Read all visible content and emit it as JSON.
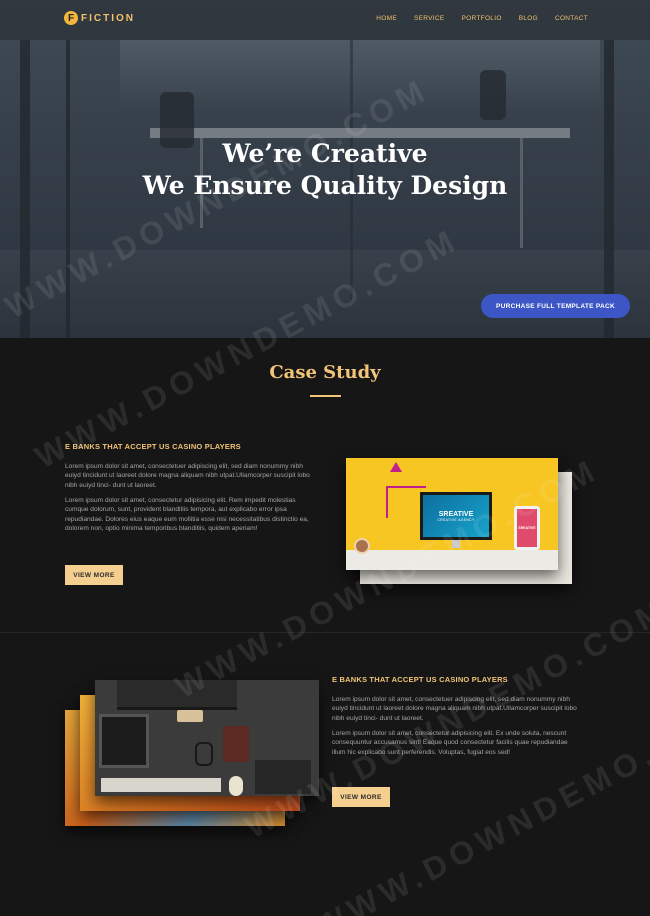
{
  "header": {
    "logo_initial": "F",
    "logo_text": "FICTION",
    "nav": [
      "HOME",
      "SERVICE",
      "PORTFOLIO",
      "BLOG",
      "CONTACT"
    ]
  },
  "hero": {
    "line1": "We’re Creative",
    "line2": "We Ensure Quality Design",
    "cta_label": "PURCHASE FULL TEMPLATE PACK"
  },
  "case_study": {
    "title": "Case Study",
    "items": [
      {
        "heading": "E BANKS THAT ACCEPT US CASINO PLAYERS",
        "para1": "Lorem ipsum dolor sit amet, consectetuer adipiscing elit, sed diam nonummy nibh euiyd tincidunt ut laoreet dolore magna aliquam nibh utpat.Ullamcorper suscipit lobo nibh euiyd tinci- dunt ut laoreet.",
        "para2": "Lorem ipsum dolor sit amet, consectetur adipisicing elit. Rem impedit molestias cumque dolorum, sunt, provident blanditiis tempora, aut explicabo error ipsa repudiandae. Dolores eius eaque eum mollitia esse nisi necessitatibus distinctio ea, dolorem non, optio minima temporibus blanditiis, quidem aperiam!",
        "button": "VIEW MORE",
        "screen_title": "SREATIVE",
        "screen_sub": "CREATIVE AGENCY",
        "phone_text": "SREATIVE"
      },
      {
        "heading": "E BANKS THAT ACCEPT US CASINO PLAYERS",
        "para1": "Lorem ipsum dolor sit amet, consectetuer adipiscing elit, sed diam nonummy nibh euiyd tincidunt ut laoreet dolore magna aliquam nibh utpat.Ullamcorper suscipit lobo nibh euiyd tinci- dunt ut laoreet.",
        "para2": "Lorem ipsum dolor sit amet, consectetur adipisicing elit. Ex unde soluta, nescunt consequuntur accusamus sint! Eaque quod consectetur facilis quae repudiandae illum hic explicabo sunt perferendis. Voluptas, fugiat eos sed!",
        "button": "VIEW MORE"
      }
    ]
  },
  "watermark": "WWW.DOWNDEMO.COM",
  "colors": {
    "accent": "#f1c477",
    "cta_blue": "#3d56c6",
    "background": "#161616"
  }
}
